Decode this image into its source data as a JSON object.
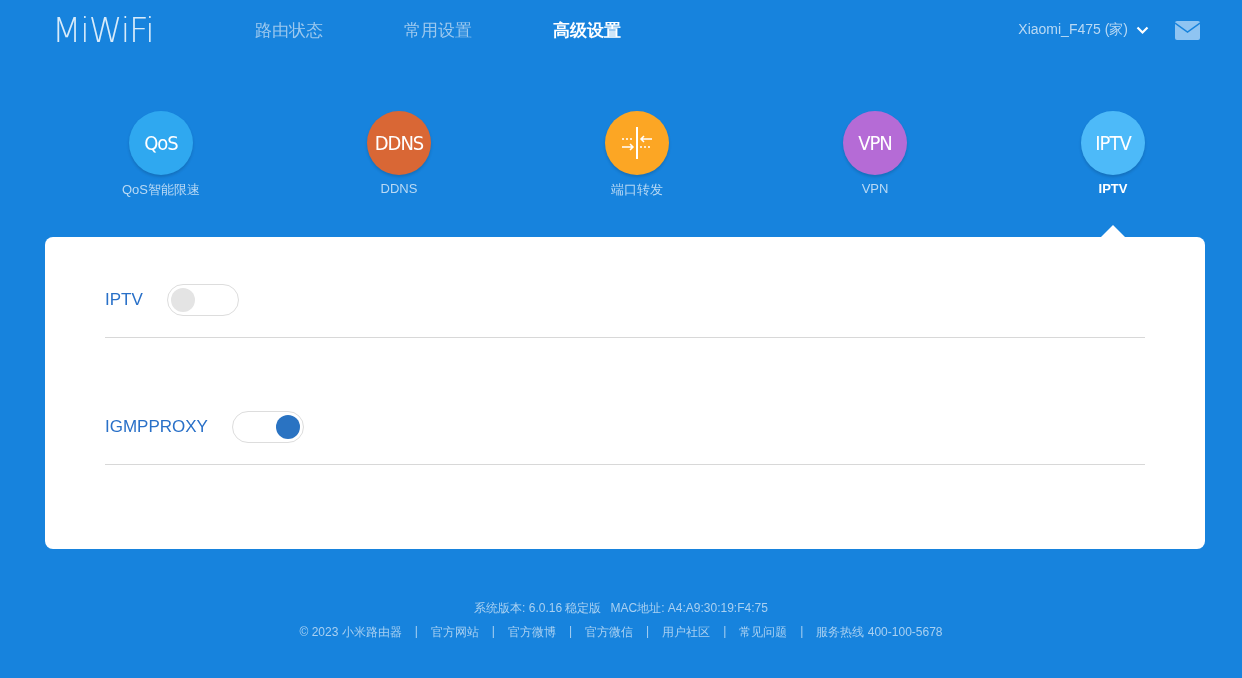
{
  "header": {
    "logo": "MiWiFi",
    "nav": [
      {
        "label": "路由状态",
        "selected": false
      },
      {
        "label": "常用设置",
        "selected": false
      },
      {
        "label": "高级设置",
        "selected": true
      }
    ],
    "router_name": "Xiaomi_F475 (家)"
  },
  "features": [
    {
      "kind": "text",
      "icon_text": "QoS",
      "label": "QoS智能限速",
      "color": "#2fa8f0",
      "selected": false
    },
    {
      "kind": "text",
      "icon_text": "DDNS",
      "label": "DDNS",
      "color": "#d96735",
      "selected": false
    },
    {
      "kind": "ports",
      "label": "端口转发",
      "color": "#fca624",
      "selected": false
    },
    {
      "kind": "text",
      "icon_text": "VPN",
      "label": "VPN",
      "color": "#b56bd6",
      "selected": false
    },
    {
      "kind": "text",
      "icon_text": "IPTV",
      "label": "IPTV",
      "color": "#4dbaf9",
      "selected": true
    }
  ],
  "settings": [
    {
      "label": "IPTV",
      "on": false
    },
    {
      "label": "IGMPPROXY",
      "on": true
    }
  ],
  "footer": {
    "version": "系统版本: 6.0.16 稳定版",
    "mac": "MAC地址: A4:A9:30:19:F4:75",
    "copyright": "© 2023 小米路由器",
    "separator": "|",
    "links": [
      "官方网站",
      "官方微博",
      "官方微信",
      "用户社区",
      "常见问题",
      "服务热线 400-100-5678"
    ]
  }
}
